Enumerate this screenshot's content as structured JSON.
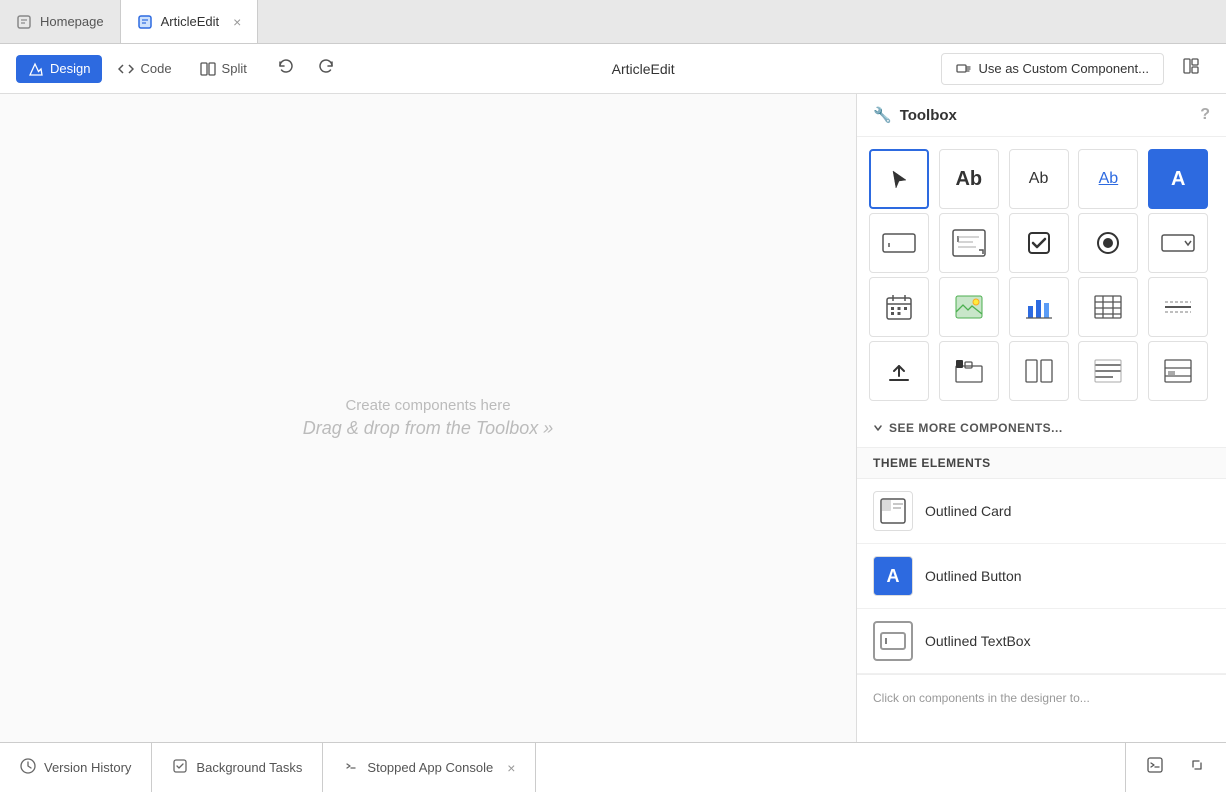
{
  "tabs": [
    {
      "id": "homepage",
      "label": "Homepage",
      "active": false,
      "closable": false,
      "icon": "home"
    },
    {
      "id": "articleedit",
      "label": "ArticleEdit",
      "active": true,
      "closable": true,
      "icon": "file"
    }
  ],
  "toolbar": {
    "design_label": "Design",
    "code_label": "Code",
    "split_label": "Split",
    "title": "ArticleEdit",
    "custom_component_label": "Use as Custom Component...",
    "undo_label": "Undo",
    "redo_label": "Redo",
    "layout_label": "Layout"
  },
  "canvas": {
    "placeholder_line1": "Create components here",
    "placeholder_line2": "Drag & drop from the Toolbox »"
  },
  "toolbox": {
    "title": "Toolbox",
    "items": [
      {
        "id": "cursor",
        "label": "Cursor",
        "type": "cursor",
        "selected": true
      },
      {
        "id": "text-heading",
        "label": "Heading",
        "type": "text-Ab-normal"
      },
      {
        "id": "text-subheading",
        "label": "Subheading",
        "type": "text-Ab-medium"
      },
      {
        "id": "text-link",
        "label": "Link",
        "type": "text-Ab-link"
      },
      {
        "id": "text-button",
        "label": "Button",
        "type": "text-A-filled"
      },
      {
        "id": "textbox",
        "label": "TextBox",
        "type": "textbox"
      },
      {
        "id": "textarea",
        "label": "TextArea",
        "type": "textarea"
      },
      {
        "id": "checkbox",
        "label": "Checkbox",
        "type": "checkbox"
      },
      {
        "id": "radio",
        "label": "Radio",
        "type": "radio"
      },
      {
        "id": "dropdown",
        "label": "Dropdown",
        "type": "dropdown"
      },
      {
        "id": "datepicker",
        "label": "DatePicker",
        "type": "datepicker"
      },
      {
        "id": "image",
        "label": "Image",
        "type": "image"
      },
      {
        "id": "chart",
        "label": "Chart",
        "type": "chart"
      },
      {
        "id": "table",
        "label": "Table",
        "type": "table"
      },
      {
        "id": "separator",
        "label": "Separator",
        "type": "separator"
      },
      {
        "id": "upload",
        "label": "Upload",
        "type": "upload"
      },
      {
        "id": "tabs-component",
        "label": "Tabs",
        "type": "tabs-component"
      },
      {
        "id": "columns",
        "label": "Columns",
        "type": "columns"
      },
      {
        "id": "list",
        "label": "List",
        "type": "list"
      },
      {
        "id": "layout",
        "label": "Layout",
        "type": "layout"
      }
    ],
    "see_more_label": "SEE MORE COMPONENTS...",
    "theme_elements_label": "THEME ELEMENTS",
    "theme_items": [
      {
        "id": "outlined-card",
        "label": "Outlined Card",
        "icon": "card"
      },
      {
        "id": "outlined-button",
        "label": "Outlined Button",
        "icon": "button-A"
      },
      {
        "id": "outlined-textbox",
        "label": "Outlined TextBox",
        "icon": "textbox-al"
      }
    ],
    "footer_hint": "Click on components in the designer to..."
  },
  "bottom_bar": {
    "version_history_label": "Version History",
    "background_tasks_label": "Background Tasks",
    "stopped_console_label": "Stopped App Console"
  },
  "colors": {
    "accent": "#2d6ae0",
    "border": "#ddd",
    "bg_light": "#fafafa"
  }
}
